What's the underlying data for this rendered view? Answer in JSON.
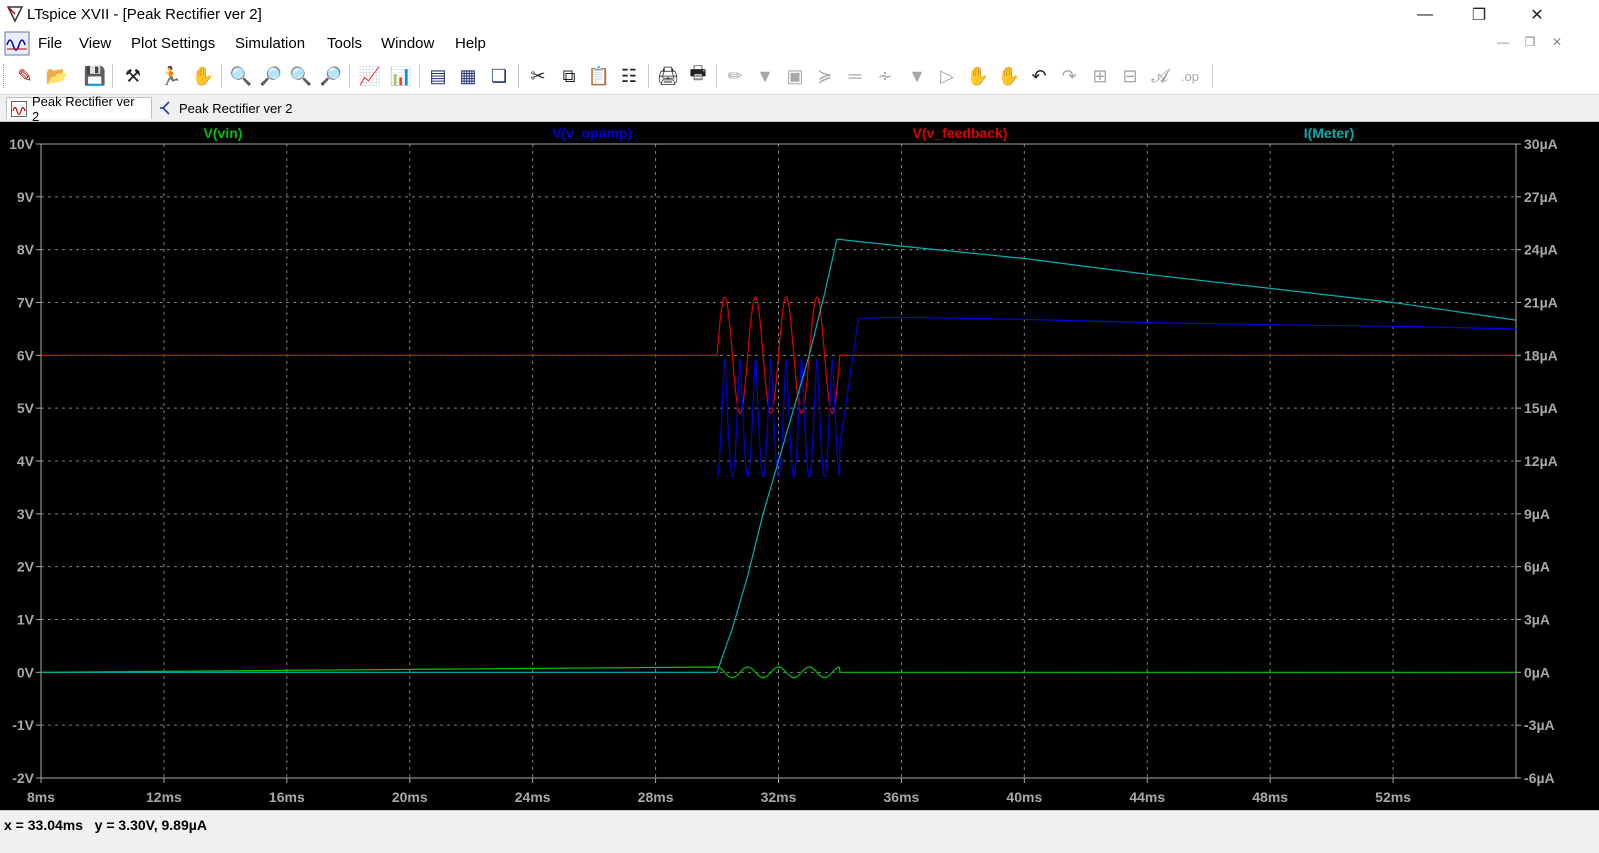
{
  "window": {
    "title": "LTspice XVII - [Peak Rectifier ver 2]",
    "minimize_icon": "minimize-icon",
    "restore_icon": "restore-icon",
    "close_icon": "close-icon"
  },
  "menu": [
    "File",
    "View",
    "Plot Settings",
    "Simulation",
    "Tools",
    "Window",
    "Help"
  ],
  "tabs": [
    {
      "label": "Peak Rectifier ver 2",
      "icon": "waveform-icon",
      "active": true
    },
    {
      "label": "Peak Rectifier ver 2",
      "icon": "schematic-icon",
      "active": false
    }
  ],
  "status": {
    "readout": "x = 33.04ms   y = 3.30V, 9.89µA"
  },
  "chart_data": {
    "type": "line",
    "traces": [
      {
        "name": "V(vin)",
        "color": "#00c000",
        "axis": "left"
      },
      {
        "name": "V(v_opamp)",
        "color": "#0000dd",
        "axis": "left"
      },
      {
        "name": "V(v_feedback)",
        "color": "#e00000",
        "axis": "left"
      },
      {
        "name": "I(Meter)",
        "color": "#00b0b0",
        "axis": "right"
      }
    ],
    "x_axis": {
      "ticks": [
        "8ms",
        "12ms",
        "16ms",
        "20ms",
        "24ms",
        "28ms",
        "32ms",
        "36ms",
        "40ms",
        "44ms",
        "48ms",
        "52ms"
      ],
      "range_ms": [
        8,
        56
      ]
    },
    "left_axis": {
      "ticks": [
        "10V",
        "9V",
        "8V",
        "7V",
        "6V",
        "5V",
        "4V",
        "3V",
        "2V",
        "1V",
        "0V",
        "-1V",
        "-2V"
      ],
      "range_V": [
        -2,
        10
      ]
    },
    "right_axis": {
      "ticks": [
        "30µA",
        "27µA",
        "24µA",
        "21µA",
        "18µA",
        "15µA",
        "12µA",
        "9µA",
        "6µA",
        "3µA",
        "0µA",
        "-3µA",
        "-6µA"
      ],
      "range_uA": [
        -6,
        30
      ]
    },
    "grid": true,
    "series_data": {
      "vin": {
        "flat_V": 0,
        "burst_start_ms": 30,
        "burst_end_ms": 34,
        "burst_freq_khz": 1,
        "burst_amp_V": 0.1
      },
      "v_feedback": {
        "flat_V": 6,
        "burst_start_ms": 30,
        "burst_end_ms": 34,
        "burst_freq_khz": 1,
        "burst_amp_V": 1.1
      },
      "v_opamp": {
        "burst_start_ms": 30,
        "burst_end_ms": 34,
        "burst_center_V": 6,
        "burst_amp_V": 2.3,
        "points": [
          [
            34,
            4.3
          ],
          [
            34.6,
            6.7
          ],
          [
            36,
            6.72
          ],
          [
            40,
            6.68
          ],
          [
            44,
            6.62
          ],
          [
            48,
            6.58
          ],
          [
            52,
            6.55
          ],
          [
            56,
            6.5
          ]
        ]
      },
      "i_meter": {
        "points": [
          [
            8,
            0
          ],
          [
            30,
            0
          ],
          [
            30.5,
            2.5
          ],
          [
            31,
            5.5
          ],
          [
            31.5,
            9
          ],
          [
            32,
            12
          ],
          [
            32.5,
            15
          ],
          [
            33,
            18
          ],
          [
            33.5,
            21.5
          ],
          [
            33.9,
            24.6
          ],
          [
            36,
            24.2
          ],
          [
            40,
            23.5
          ],
          [
            44,
            22.6
          ],
          [
            48,
            21.8
          ],
          [
            52,
            21
          ],
          [
            56,
            20
          ]
        ]
      }
    }
  }
}
